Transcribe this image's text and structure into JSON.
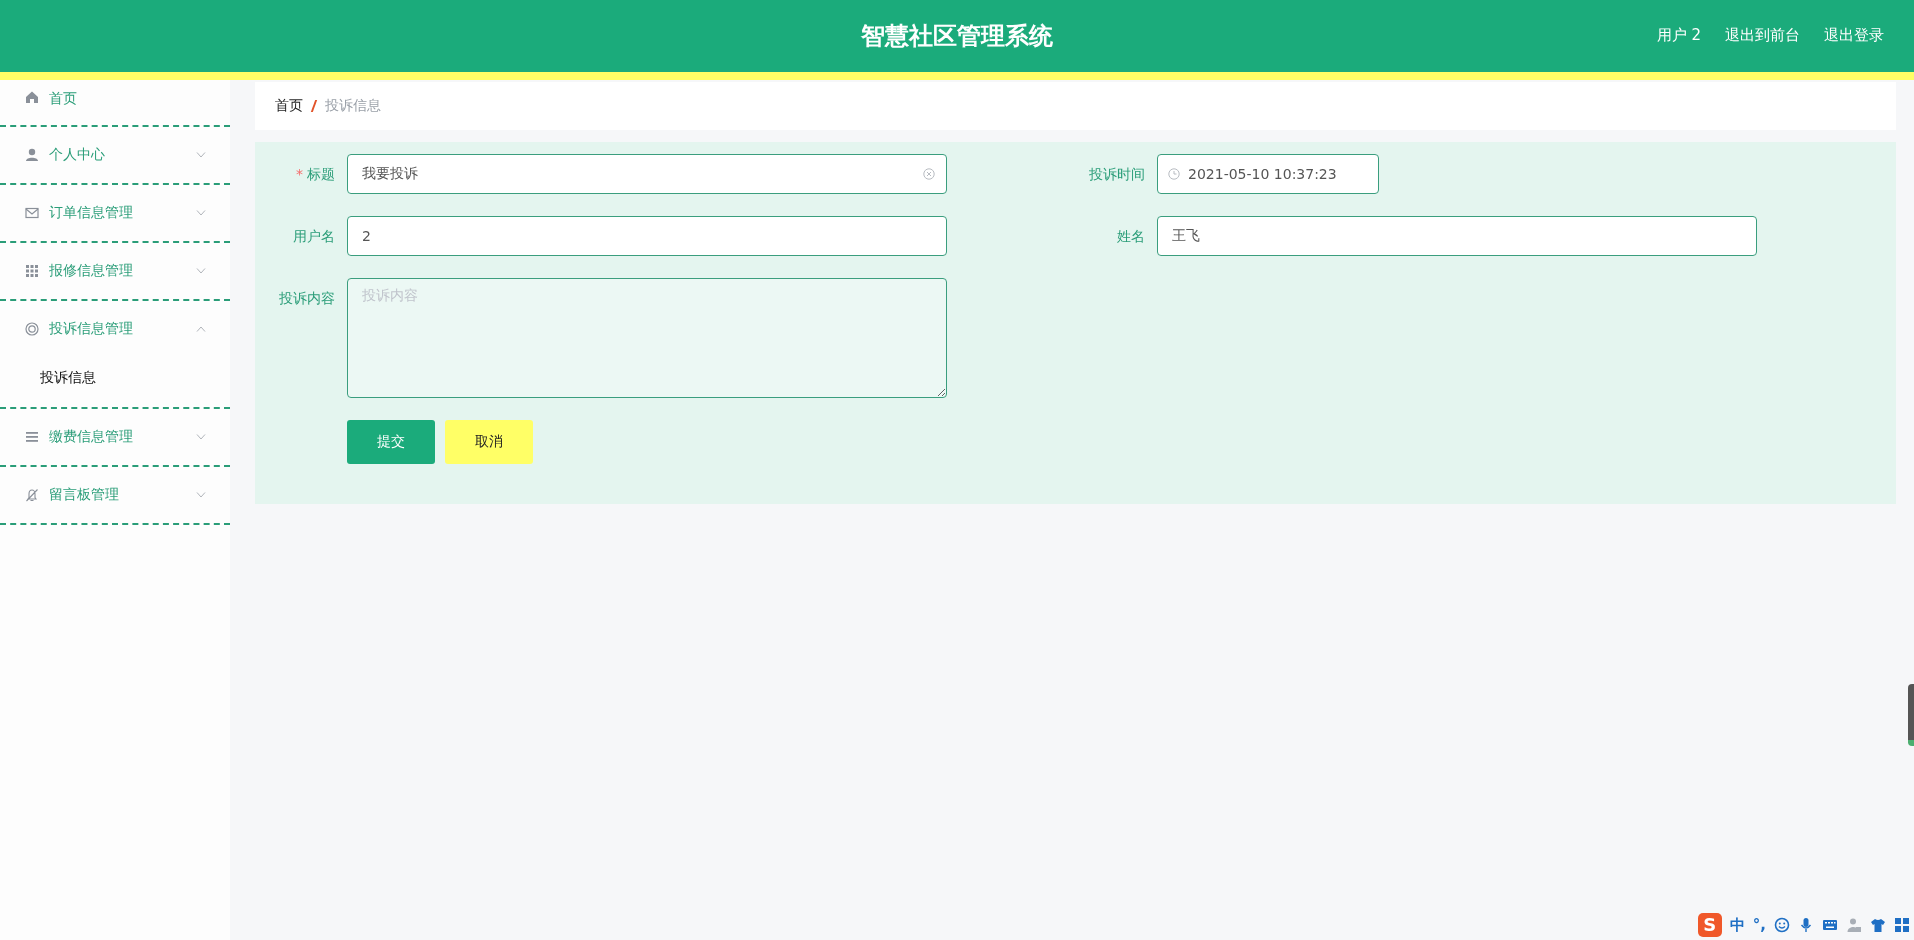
{
  "header": {
    "title": "智慧社区管理系统",
    "links": [
      "用户 2",
      "退出到前台",
      "退出登录"
    ]
  },
  "sidebar": {
    "items": [
      {
        "label": "首页"
      },
      {
        "label": "个人中心",
        "expanded": false
      },
      {
        "label": "订单信息管理",
        "expanded": false
      },
      {
        "label": "报修信息管理",
        "expanded": false
      },
      {
        "label": "投诉信息管理",
        "expanded": true,
        "children": [
          {
            "label": "投诉信息",
            "selected": true
          }
        ]
      },
      {
        "label": "缴费信息管理",
        "expanded": false
      },
      {
        "label": "留言板管理",
        "expanded": false
      }
    ]
  },
  "breadcrumb": [
    "首页",
    "投诉信息"
  ],
  "form": {
    "rows": [
      [
        {
          "kind": "text",
          "label": "标题",
          "required_mark": "*",
          "value": "我要投诉",
          "clearable": true
        },
        {
          "kind": "datetime",
          "label": "投诉时间",
          "value": "2021-05-10 10:37:23"
        }
      ],
      [
        {
          "kind": "text",
          "label": "用户名",
          "value": "2"
        },
        {
          "kind": "text",
          "label": "姓名",
          "value": "王飞"
        }
      ],
      [
        {
          "kind": "textarea",
          "label": "投诉内容",
          "placeholder": "投诉内容"
        }
      ]
    ],
    "buttons": [
      {
        "kind": "primary",
        "label": "提交"
      },
      {
        "kind": "cancel",
        "label": "取消"
      }
    ]
  },
  "ime_toolbar": {
    "logo": "S",
    "items": [
      "中",
      "°,"
    ]
  }
}
